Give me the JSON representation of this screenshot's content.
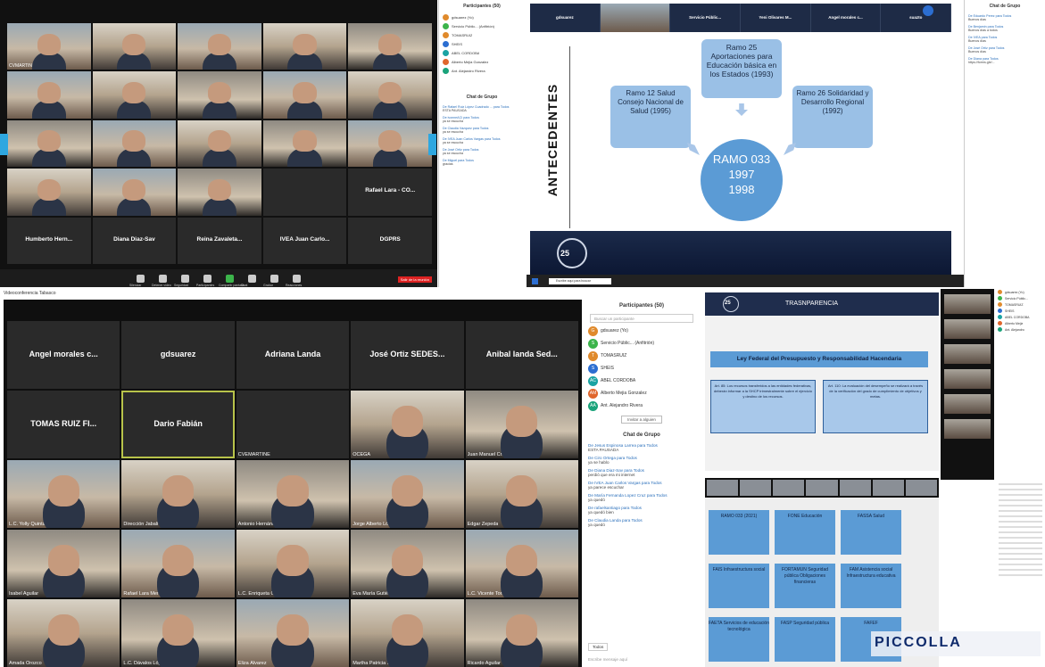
{
  "q1": {
    "tiles": [
      {
        "name": "CVMARTINE",
        "cam": "cam"
      },
      {
        "name": "",
        "cam": "cam2"
      },
      {
        "name": "",
        "cam": "cam"
      },
      {
        "name": "",
        "cam": "cam2"
      },
      {
        "name": "",
        "cam": "cam3"
      },
      {
        "name": "",
        "cam": "cam"
      },
      {
        "name": "",
        "cam": "cam2"
      },
      {
        "name": "",
        "cam": "cam3"
      },
      {
        "name": "",
        "cam": "cam"
      },
      {
        "name": "",
        "cam": "cam2"
      },
      {
        "name": "",
        "cam": "cam3"
      },
      {
        "name": "",
        "cam": "cam"
      },
      {
        "name": "",
        "cam": "cam2"
      },
      {
        "name": "",
        "cam": "cam3"
      },
      {
        "name": "",
        "cam": "cam"
      },
      {
        "name": "",
        "cam": "cam2"
      },
      {
        "name": "",
        "cam": "cam"
      },
      {
        "name": "",
        "cam": "cam3"
      },
      {
        "name": "",
        "cam": ""
      },
      {
        "big": "Rafael Lara - CO..."
      },
      {
        "big": "Humberto Hern..."
      },
      {
        "big": "Diana Diaz-Sav"
      },
      {
        "big": "Reina Zavaleta..."
      },
      {
        "big": "IVEA Juan Carlo..."
      },
      {
        "big": "DGPRS"
      }
    ],
    "participants_title": "Participantes (50)",
    "participants": [
      "gdsuarez (Yo)",
      "Servicio Públic... (Anfitrión)",
      "TOMASRUIZ",
      "SHEIS",
      "ABEL CORDOBA",
      "Alberto Mejia Gonzalez",
      "Ant. Alejandro Rivera"
    ],
    "chat_title": "Chat de Grupo",
    "chat": [
      {
        "from": "De Rafael Ruiz López Cuadrado ... para Todos",
        "msg": "ESTA PAUSADA"
      },
      {
        "from": "De ivonneACI para Todos",
        "msg": "ya se escucha"
      },
      {
        "from": "De Claudia Vázquez para Todos",
        "msg": "ya se escucha"
      },
      {
        "from": "De IVEA Juan Carlos Vargas para Todos",
        "msg": "ya se escucha"
      },
      {
        "from": "De José Ortiz para Todos",
        "msg": "ya se escucha"
      },
      {
        "from": "De Miguel para Todos",
        "msg": "gracias"
      }
    ],
    "toolbar": [
      "Silenciar",
      "Detener video",
      "Seguridad",
      "Participantes",
      "Compartir pantalla",
      "Chat",
      "Grabar",
      "Reacciones"
    ],
    "end": "Salir de la reunión"
  },
  "q2": {
    "strip": [
      "gdsuarez",
      "",
      "Servicio Públic...",
      "Yeni Olivares M...",
      "Angel morales c...",
      "suazto"
    ],
    "side_label": "ANTECEDENTES",
    "boxes": {
      "top": "Ramo 25 Aportaciones para Educación básica en los Estados (1993)",
      "left": "Ramo 12 Salud Consejo Nacional de Salud (1995)",
      "right": "Ramo 26 Solidaridad y Desarrollo Regional (1992)"
    },
    "center": [
      "RAMO 033",
      "1997",
      "1998"
    ],
    "logo_text": "25",
    "search": "Escribe aquí para buscar",
    "chat_title": "Chat de Grupo",
    "chat": [
      {
        "from": "De Eduardo Perez para Todos",
        "msg": "Buenos días"
      },
      {
        "from": "De Benjamin para Todos",
        "msg": "Buenos días a todos"
      },
      {
        "from": "De IVEA para Todos",
        "msg": "Buenos días"
      },
      {
        "from": "De José Ortiz para Todos",
        "msg": "Buenos días"
      },
      {
        "from": "De Diana para Todos",
        "msg": "https://forms.gle/..."
      }
    ]
  },
  "q3": {
    "window_title": "Videoconferencia Tabasco",
    "tiles": [
      {
        "big": "Angel morales c..."
      },
      {
        "big": "gdsuarez"
      },
      {
        "big": "Adriana Landa"
      },
      {
        "big": "José Ortiz SEDES..."
      },
      {
        "big": "Anibal landa Sed..."
      },
      {
        "big": "TOMAS RUIZ FI..."
      },
      {
        "big": "Dario Fabián",
        "hl": true
      },
      {
        "name": "CVEMARTINE"
      },
      {
        "name": "OCEGA",
        "cam": "cam2"
      },
      {
        "name": "Juan Manuel Cruz Hdez",
        "cam": "cam3"
      },
      {
        "name": "L.C. Yolly Quintana Rodriguez",
        "cam": "cam"
      },
      {
        "name": "Dirección Jabali",
        "cam": "cam2"
      },
      {
        "name": "Antonio Hernández Zavala",
        "cam": "cam3"
      },
      {
        "name": "Jorge Alberto López",
        "cam": "cam"
      },
      {
        "name": "Edgar Zepeda",
        "cam": "cam2"
      },
      {
        "name": "Isabel Aguilar",
        "cam": "cam3"
      },
      {
        "name": "Rafael Lara Mena",
        "cam": "cam"
      },
      {
        "name": "L.C. Enriqueta Gómez",
        "cam": "cam2"
      },
      {
        "name": "Eva María Gutiérrez",
        "cam": "cam3"
      },
      {
        "name": "L.C. Vicente Torres",
        "cam": "cam"
      },
      {
        "name": "Amada Orozco",
        "cam": "cam2"
      },
      {
        "name": "L.C. Dávalos López López",
        "cam": "cam3"
      },
      {
        "name": "Eliza Álvarez",
        "cam": "cam"
      },
      {
        "name": "Martha Patricia Santiago",
        "cam": "cam2"
      },
      {
        "name": "Ricardo Aguilar",
        "cam": "cam3"
      }
    ],
    "participants_title": "Participantes (50)",
    "search": "Buscar un participante",
    "participants": [
      {
        "name": "gdsuarez (Yo)",
        "color": "#e08a2c",
        "i": "G"
      },
      {
        "name": "Servicio Públic... (Anfitrión)",
        "color": "#3cb44b",
        "i": "S"
      },
      {
        "name": "TOMASRUIZ",
        "color": "#e08a2c",
        "i": "T"
      },
      {
        "name": "SHEIS",
        "color": "#2c6ed1",
        "i": "S"
      },
      {
        "name": "ABEL CORDOBA",
        "color": "#1aa3a3",
        "i": "AC"
      },
      {
        "name": "Alberto Mejia Gonzalez",
        "color": "#e0662c",
        "i": "AM"
      },
      {
        "name": "Ant. Alejandro Rivera",
        "color": "#1aa37a",
        "i": "AA"
      }
    ],
    "invite": "Invitar a alguien",
    "chat_title": "Chat de Grupo",
    "chat": [
      {
        "from": "De Jesus Espinosa Larrea para Todos",
        "msg": "ESTA PAUSADA"
      },
      {
        "from": "De Ciro Ortega para Todos",
        "msg": "ya se hablo"
      },
      {
        "from": "De Diana Diaz-Sav para Todos",
        "msg": "perdió que era mi internet"
      },
      {
        "from": "De IVEA Juan Carlos Vargas para Todos",
        "msg": "ya parece escuchar"
      },
      {
        "from": "De María Fernanda Lopez Cruz para Todos",
        "msg": "ya quedó"
      },
      {
        "from": "De rafaelsantiago para Todos",
        "msg": "ya quedó bien"
      },
      {
        "from": "De Claudia Landa para Todos",
        "msg": "ya quedó"
      }
    ],
    "to": "Todos",
    "input": "Escribe mensaje aquí"
  },
  "q4": {
    "slide_title": "TRASNPARENCIA",
    "logo_text": "25",
    "law": "Ley Federal del Presupuesto y Responsabilidad Hacendaria",
    "art_left": "Art. 85: Los recursos transferidos a las entidades federativas, deberán informar a la SHCP trimestralmente sobre el ejercicio y destino de los recursos.",
    "art_right": "Art. 110: La evaluación del desempeño se realizará a través de la verificación del grado de cumplimiento de objetivos y metas.",
    "grid": [
      "RAMO 033 (2021)",
      "FONE Educación",
      "FASSA Salud",
      "FAIS Infraestructura social",
      "FORTAMUN Seguridad pública Obligaciones financieras",
      "FAM Asistencia social Infraestructura educativa",
      "FAETA Servicios de educación tecnológica",
      "FASP Seguridad pública",
      "FAFEF"
    ],
    "watermark": "PICCOLLA",
    "participants": [
      "gdsuarez (Yo)",
      "Servicio Públic...",
      "TOMASRUIZ",
      "SHEIS",
      "ABEL CORDOBA",
      "Alberto Mejia",
      "Ant. Alejandro"
    ]
  }
}
